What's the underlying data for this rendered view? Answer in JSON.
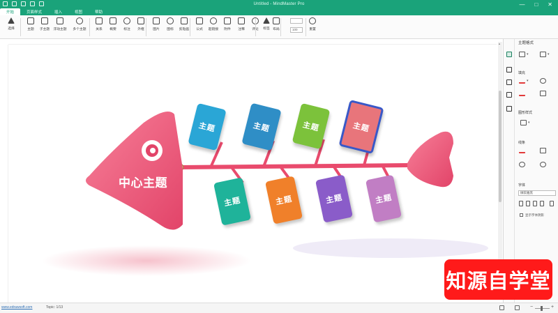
{
  "window": {
    "title": "Untitled - MindMaster Pro",
    "controls": [
      "—",
      "□",
      "✕"
    ]
  },
  "menu": {
    "items": [
      "开始",
      "页面样式",
      "插入",
      "视图",
      "帮助"
    ]
  },
  "toolbar": {
    "tools": [
      {
        "icon": "select-icon",
        "label": "选择"
      },
      {
        "icon": "topic-icon",
        "label": "主题"
      },
      {
        "icon": "subtopic-icon",
        "label": "子主题"
      },
      {
        "icon": "floating-topic-icon",
        "label": "浮动主题"
      },
      {
        "icon": "multi-topic-icon",
        "label": "多个主题"
      },
      {
        "icon": "relationship-icon",
        "label": "关系"
      },
      {
        "icon": "summary-icon",
        "label": "概要"
      },
      {
        "icon": "callout-icon",
        "label": "标注"
      },
      {
        "icon": "boundary-icon",
        "label": "外框"
      },
      {
        "icon": "image-icon",
        "label": "图片"
      },
      {
        "icon": "icon-icon",
        "label": "图标"
      },
      {
        "icon": "clipart-icon",
        "label": "剪贴画"
      },
      {
        "icon": "formula-icon",
        "label": "公式"
      },
      {
        "icon": "link-icon",
        "label": "超链接"
      },
      {
        "icon": "attachment-icon",
        "label": "附件"
      },
      {
        "icon": "note-icon",
        "label": "注释"
      },
      {
        "icon": "comment-icon",
        "label": "评论"
      },
      {
        "icon": "tag-icon",
        "label": "标签"
      },
      {
        "icon": "layout-icon",
        "label": "布局"
      },
      {
        "icon": "numbering-icon",
        "label": "编号"
      },
      {
        "icon": "reset-icon",
        "label": "重置"
      }
    ],
    "zoom_value": "100"
  },
  "canvas": {
    "central_topic": "中心主题",
    "upper_branches": [
      {
        "label": "主题",
        "color": "#2aa6d6"
      },
      {
        "label": "主题",
        "color": "#2f8ec6"
      },
      {
        "label": "主题",
        "color": "#7cc23b"
      },
      {
        "label": "主题",
        "color": "#e8757b"
      }
    ],
    "lower_branches": [
      {
        "label": "主题",
        "color": "#1fb39a"
      },
      {
        "label": "主题",
        "color": "#f0802a"
      },
      {
        "label": "主题",
        "color": "#8a5cc9"
      },
      {
        "label": "主题",
        "color": "#c17ec4"
      }
    ],
    "fish_color": "#ef5b7a",
    "spine_color": "#e94b6d"
  },
  "right_panel": {
    "title": "主题格式",
    "section_fill": "填充",
    "section_shape": "图形样式",
    "section_line": "线条",
    "section_text": "字体",
    "font_select": "微软雅黑",
    "size_select": "18",
    "checkbox_label": "显示字体阴影"
  },
  "status": {
    "link": "www.edrawsoft.com",
    "text": "Topic: 1/13"
  },
  "brand": {
    "badge_text": "知源自学堂",
    "badge_color": "#ff1a1a"
  }
}
